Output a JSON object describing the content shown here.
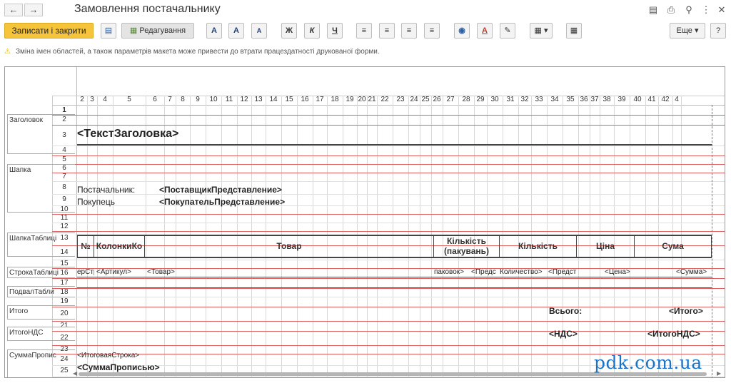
{
  "window": {
    "title": "Замовлення постачальнику"
  },
  "toolbar": {
    "save_close": "Записати і закрити",
    "edit": "Редагування",
    "font_bold_a": "A",
    "font_big_a": "A",
    "font_small_a": "A",
    "bold": "Ж",
    "italic": "К",
    "underline": "Ч",
    "more": "Еще",
    "help": "?"
  },
  "warning": {
    "text": "Зміна імен областей, а також параметрів макета може привести до втрати працездатності друкованої форми."
  },
  "columns": [
    "2",
    "3",
    "4",
    "5",
    "6",
    "7",
    "8",
    "9",
    "10",
    "11",
    "12",
    "13",
    "14",
    "15",
    "16",
    "17",
    "18",
    "19",
    "20",
    "21",
    "22",
    "23",
    "24",
    "25",
    "26",
    "27",
    "28",
    "29",
    "30",
    "31",
    "32",
    "33",
    "34",
    "35",
    "36",
    "37",
    "38",
    "39",
    "40",
    "41",
    "42",
    "4"
  ],
  "rows": [
    "1",
    "2",
    "3",
    "4",
    "5",
    "6",
    "7",
    "8",
    "9",
    "10",
    "11",
    "12",
    "13",
    "14",
    "15",
    "16",
    "17",
    "18",
    "19",
    "20",
    "21",
    "22",
    "23",
    "24",
    "25"
  ],
  "areas": [
    "Заголовок",
    "Шапка",
    "ШапкаТаблиці",
    "СтрокаТаблиці",
    "ПодвалТабли",
    "Итого",
    "ИтогоНДС",
    "СуммаПропис"
  ],
  "cells": {
    "title_param": "<ТекстЗаголовка>",
    "supplier_label": "Постачальник:",
    "supplier_value": "<ПоставщикПредставление>",
    "buyer_label": "Покупець",
    "buyer_value": "<ПокупательПредставление>",
    "h_num": "№",
    "h_cols": "КолонкиКо",
    "h_goods": "Товар",
    "h_qty_pack_1": "Кількість",
    "h_qty_pack_2": "(пакувань)",
    "h_qty": "Кількість",
    "h_price": "Ціна",
    "h_sum": "Сума",
    "r_num": "ерСтр",
    "r_art": "<Артикул>",
    "r_goods": "<Товар>",
    "r_pack": "паковок>",
    "r_pred1": "<Предс",
    "r_qty": "Количество>",
    "r_pred2": "<Предст",
    "r_price": "<Цена>",
    "r_sum": "<Сумма>",
    "total_label": "Всього:",
    "total_value": "<Итого>",
    "vat_label": "<НДС>",
    "vat_value": "<ИтогоНДС>",
    "total_line": "<ИтоговаяСтрока>",
    "sum_words": "<СуммаПрописью>"
  },
  "watermark": "pdk.com.ua"
}
